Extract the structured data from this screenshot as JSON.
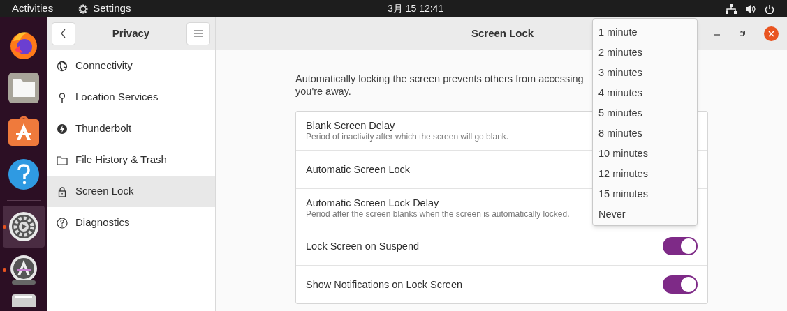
{
  "top_bar": {
    "activities": "Activities",
    "app": "Settings",
    "clock": "3月 15  12:41"
  },
  "dock": [
    {
      "kind": "firefox",
      "running": false,
      "selected": false
    },
    {
      "kind": "files",
      "running": false,
      "selected": false
    },
    {
      "kind": "software",
      "running": false,
      "selected": false
    },
    {
      "kind": "help",
      "running": false,
      "selected": false
    },
    {
      "kind": "separator"
    },
    {
      "kind": "settings",
      "running": true,
      "selected": true
    },
    {
      "kind": "updater",
      "running": true,
      "selected": false
    },
    {
      "kind": "drive",
      "running": false,
      "selected": false
    }
  ],
  "sidebar": {
    "title": "Privacy",
    "items": [
      {
        "label": "Connectivity",
        "selected": false
      },
      {
        "label": "Location Services",
        "selected": false
      },
      {
        "label": "Thunderbolt",
        "selected": false
      },
      {
        "label": "File History & Trash",
        "selected": false
      },
      {
        "label": "Screen Lock",
        "selected": true
      },
      {
        "label": "Diagnostics",
        "selected": false
      }
    ]
  },
  "main": {
    "title": "Screen Lock",
    "description_lines": [
      "Automatically locking the screen prevents others from accessing",
      "you're away."
    ],
    "rows": [
      {
        "kind": "plain",
        "title": "Blank Screen Delay",
        "subtitle": "Period of inactivity after which the screen will go blank."
      },
      {
        "kind": "plain",
        "title": "Automatic Screen Lock"
      },
      {
        "kind": "plain",
        "title": "Automatic Screen Lock Delay",
        "subtitle": "Period after the screen blanks when the screen is automatically locked."
      },
      {
        "kind": "toggle",
        "title": "Lock Screen on Suspend",
        "on": true
      },
      {
        "kind": "toggle",
        "title": "Show Notifications on Lock Screen",
        "on": true
      }
    ]
  },
  "popup": {
    "items": [
      "1 minute",
      "2 minutes",
      "3 minutes",
      "4 minutes",
      "5 minutes",
      "8 minutes",
      "10 minutes",
      "12 minutes",
      "15 minutes",
      "Never"
    ]
  }
}
